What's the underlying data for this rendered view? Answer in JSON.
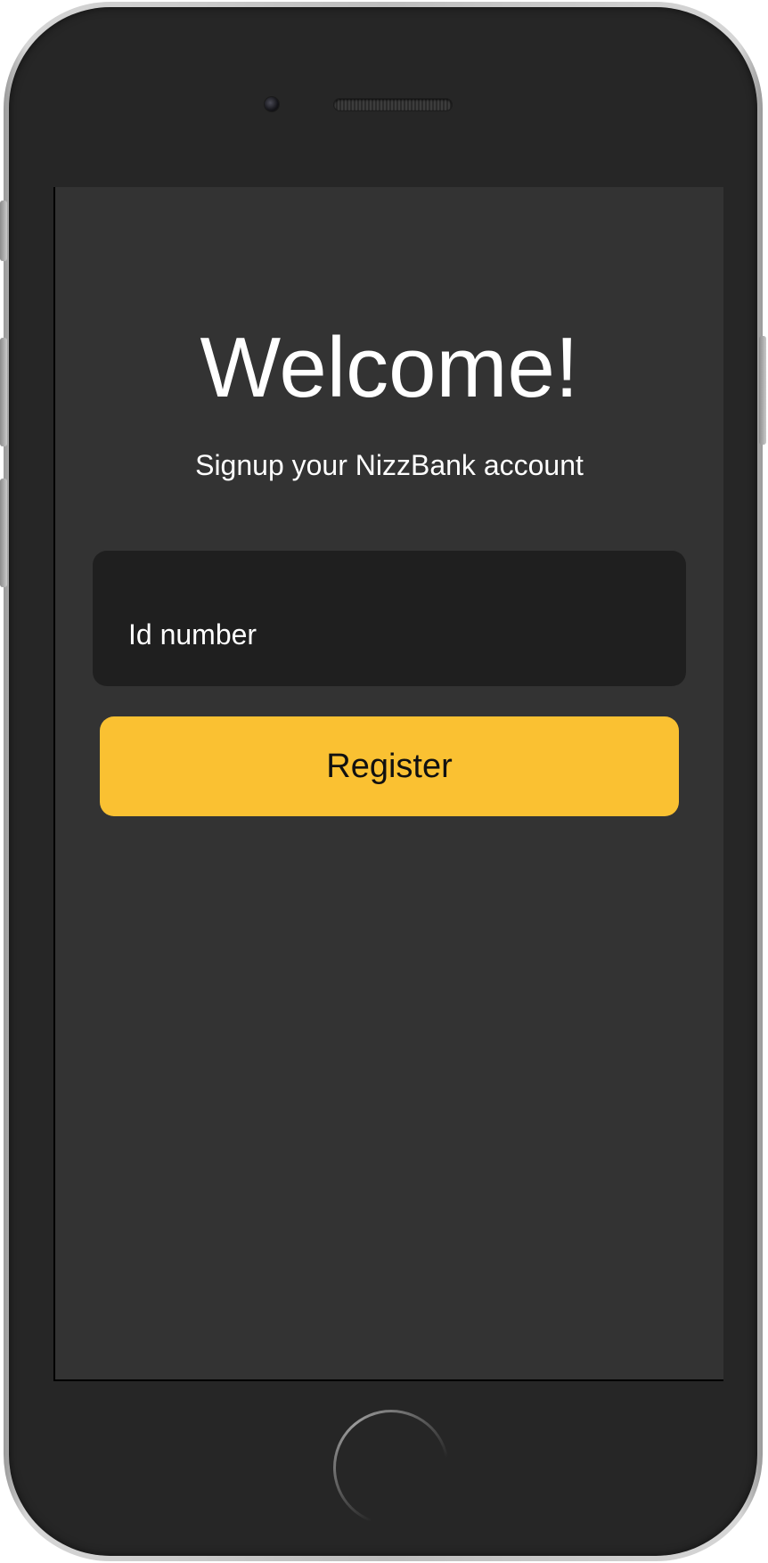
{
  "screen": {
    "title": "Welcome!",
    "subtitle": "Signup your NizzBank account"
  },
  "form": {
    "id_field_label": "Id number",
    "register_label": "Register"
  },
  "colors": {
    "background": "#333333",
    "field_background": "#1f1f1f",
    "accent": "#fac132",
    "text": "#ffffff",
    "device_body": "#262626"
  },
  "icons": {
    "front_camera": "camera-icon",
    "earpiece": "speaker-icon",
    "home": "home-button-icon"
  }
}
